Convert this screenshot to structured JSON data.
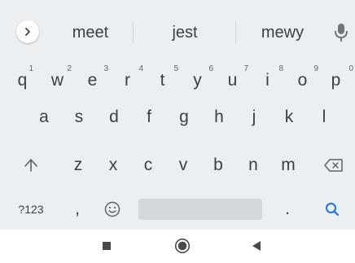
{
  "suggestions": {
    "items": [
      "meet",
      "jest",
      "mewy"
    ]
  },
  "rows": {
    "top": [
      {
        "letter": "q",
        "hint": "1"
      },
      {
        "letter": "w",
        "hint": "2"
      },
      {
        "letter": "e",
        "hint": "3"
      },
      {
        "letter": "r",
        "hint": "4"
      },
      {
        "letter": "t",
        "hint": "5"
      },
      {
        "letter": "y",
        "hint": "6"
      },
      {
        "letter": "u",
        "hint": "7"
      },
      {
        "letter": "i",
        "hint": "8"
      },
      {
        "letter": "o",
        "hint": "9"
      },
      {
        "letter": "p",
        "hint": "0"
      }
    ],
    "middle": [
      "a",
      "s",
      "d",
      "f",
      "g",
      "h",
      "j",
      "k",
      "l"
    ],
    "bottom": [
      "z",
      "x",
      "c",
      "v",
      "b",
      "n",
      "m"
    ]
  },
  "function_row": {
    "symbols_label": "?123",
    "comma_label": ",",
    "period_label": "."
  },
  "icons": {
    "expand": "chevron-right-icon",
    "mic": "mic-icon",
    "shift": "shift-arrow-icon",
    "backspace": "backspace-icon",
    "emoji": "emoji-icon",
    "search": "search-icon",
    "nav_recents": "square-recents-icon",
    "nav_home": "circle-home-icon",
    "nav_back": "triangle-back-icon"
  },
  "colors": {
    "keyboard_bg": "#eceff1",
    "key_text": "#3c4043",
    "accent": "#1a73e8"
  }
}
